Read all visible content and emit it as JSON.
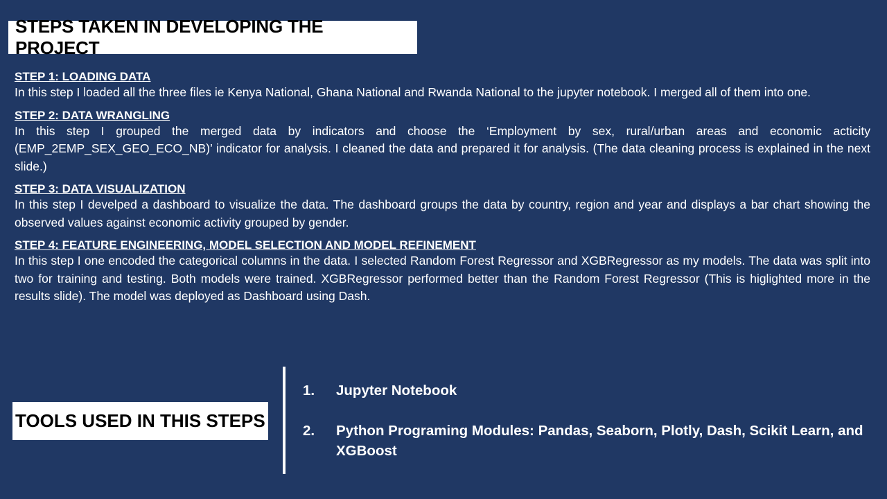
{
  "title": "STEPS TAKEN IN DEVELOPING THE PROJECT",
  "steps": [
    {
      "heading": "STEP 1: LOADING DATA",
      "body": "In this step I loaded all the three files ie Kenya National, Ghana National and Rwanda National to the jupyter notebook. I merged all of them into one."
    },
    {
      "heading": "STEP 2: DATA WRANGLING",
      "body": "In this step I grouped the merged data by indicators and choose the ‘Employment by sex, rural/urban areas and economic acticity (EMP_2EMP_SEX_GEO_ECO_NB)’  indicator for analysis.  I cleaned the data and prepared it for analysis. (The data cleaning process is explained in the next slide.)"
    },
    {
      "heading": "STEP 3: DATA VISUALIZATION",
      "body": "In this step I develped a dashboard to visualize the data. The dashboard groups the data by country, region and year and displays a bar chart showing the observed values against economic activity grouped by gender."
    },
    {
      "heading": "STEP 4: FEATURE ENGINEERING, MODEL SELECTION AND MODEL REFINEMENT",
      "body": "In this step I one encoded the categorical columns in the data. I selected Random Forest Regressor and XGBRegressor  as my models. The data was split into two for training and testing. Both models were trained. XGBRegressor performed better than the Random Forest Regressor (This is higlighted more in the results slide). The model was deployed as Dashboard using Dash."
    }
  ],
  "tools": {
    "heading": "TOOLS USED IN THIS STEPS",
    "items": [
      {
        "number": "1.",
        "text": "Jupyter Notebook"
      },
      {
        "number": "2.",
        "text": "Python Programing Modules: Pandas, Seaborn, Plotly, Dash, Scikit Learn, and XGBoost"
      }
    ]
  },
  "colors": {
    "background": "#203864",
    "text": "#ffffff",
    "title_box": "#ffffff",
    "title_text": "#000000"
  }
}
